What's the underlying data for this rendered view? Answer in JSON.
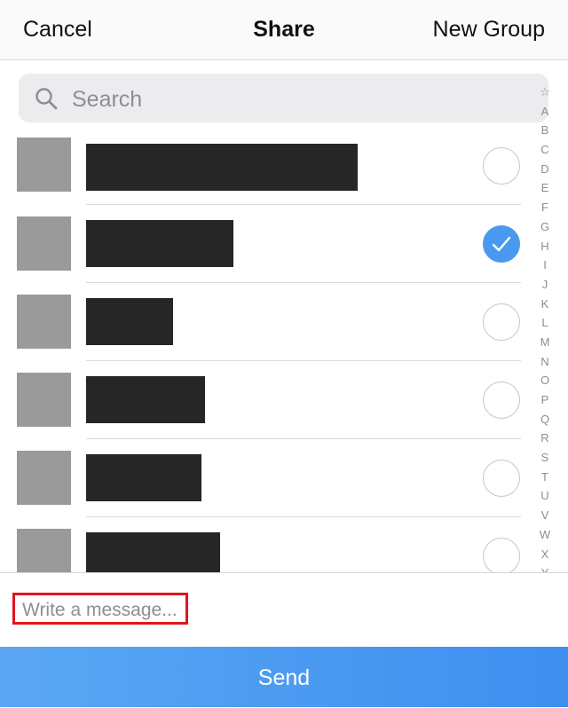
{
  "navbar": {
    "cancel_label": "Cancel",
    "title": "Share",
    "new_group_label": "New Group"
  },
  "search": {
    "placeholder": "Search",
    "value": "",
    "icon": "search-icon"
  },
  "contacts": [
    {
      "avatar": "redacted",
      "name": "redacted",
      "selected": false
    },
    {
      "avatar": "redacted",
      "name": "redacted",
      "selected": true
    },
    {
      "avatar": "redacted",
      "name": "redacted",
      "selected": false
    },
    {
      "avatar": "redacted",
      "name": "redacted",
      "selected": false
    },
    {
      "avatar": "redacted",
      "name": "redacted",
      "selected": false
    },
    {
      "avatar": "redacted",
      "name": "redacted",
      "selected": false
    }
  ],
  "section_index": [
    "☆",
    "A",
    "B",
    "C",
    "D",
    "E",
    "F",
    "G",
    "H",
    "I",
    "J",
    "K",
    "L",
    "M",
    "N",
    "O",
    "P",
    "Q",
    "R",
    "S",
    "T",
    "U",
    "V",
    "W",
    "X",
    "Y"
  ],
  "message": {
    "placeholder": "Write a message...",
    "value": ""
  },
  "send_label": "Send",
  "colors": {
    "accent": "#4a99f0",
    "send_gradient_start": "#5ba7f4",
    "send_gradient_end": "#3d8ff0",
    "highlight_border": "#e0141e",
    "avatar_placeholder": "#9a9a9a",
    "redaction": "#262626"
  }
}
